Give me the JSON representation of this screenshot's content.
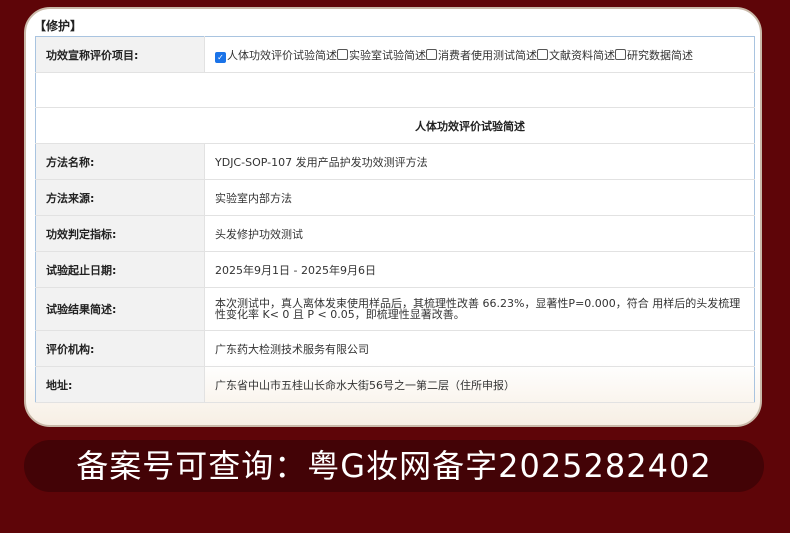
{
  "section_title": "【修护】",
  "claims": {
    "label": "功效宣称评价项目:",
    "options": [
      {
        "label": "人体功效评价试验简述",
        "checked": true
      },
      {
        "label": "实验室试验简述",
        "checked": false
      },
      {
        "label": "消费者使用测试简述",
        "checked": false
      },
      {
        "label": "文献资料简述",
        "checked": false
      },
      {
        "label": "研究数据简述",
        "checked": false
      }
    ]
  },
  "subtitle": "人体功效评价试验简述",
  "rows": [
    {
      "label": "方法名称:",
      "value": "YDJC-SOP-107 发用产品护发功效测评方法"
    },
    {
      "label": "方法来源:",
      "value": "实验室内部方法"
    },
    {
      "label": "功效判定指标:",
      "value": "头发修护功效测试"
    },
    {
      "label": "试验起止日期:",
      "value": "2025年9月1日 - 2025年9月6日"
    },
    {
      "label": "试验结果简述:",
      "value": "本次测试中，真人离体发束使用样品后，其梳理性改善 66.23%，显著性P=0.000，符合 用样后的头发梳理性变化率 K< 0 且 P < 0.05，即梳理性显著改善。"
    },
    {
      "label": "评价机构:",
      "value": "广东药大检测技术服务有限公司"
    },
    {
      "label": "地址:",
      "value": "广东省中山市五桂山长命水大街56号之一第二层（住所申报）"
    }
  ],
  "banner": "备案号可查询：粤G妆网备字2025282402"
}
